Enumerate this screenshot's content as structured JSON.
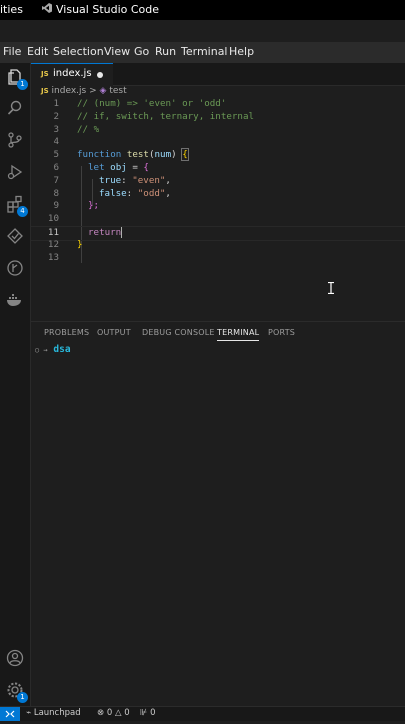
{
  "system_bar": {
    "left_text": "ities",
    "app_name": "Visual Studio Code"
  },
  "menu": [
    "File",
    "Edit",
    "Selection",
    "View",
    "Go",
    "Run",
    "Terminal",
    "Help"
  ],
  "activity": {
    "explorer_badge": "1",
    "extensions_badge": "4",
    "settings_badge": "1"
  },
  "tab": {
    "file_label": "index.js",
    "js_badge": "JS"
  },
  "breadcrumb": {
    "file": "index.js",
    "sep": ">",
    "symbol": "test"
  },
  "code": {
    "line_numbers": [
      "1",
      "2",
      "3",
      "4",
      "5",
      "6",
      "7",
      "8",
      "9",
      "10",
      "11",
      "12",
      "13"
    ],
    "l1": "// (num) => 'even' or 'odd'",
    "l2": "// if, switch, ternary, internal",
    "l3": "// %",
    "l5_kw": "function",
    "l5_fn": "test",
    "l5_open": "(",
    "l5_param": "num",
    "l5_close": ")",
    "l5_brace": "{",
    "l6_kw": "let",
    "l6_var": "obj",
    "l6_eq": "=",
    "l6_brace": "{",
    "l7_key": "true",
    "l7_str": "\"even\"",
    "l8_key": "false",
    "l8_str": "\"odd\"",
    "l9": "};",
    "l11_kw": "return",
    "l12_brace": "}"
  },
  "panel": {
    "tabs": [
      "PROBLEMS",
      "OUTPUT",
      "DEBUG CONSOLE",
      "TERMINAL",
      "PORTS"
    ],
    "active_tab": "TERMINAL",
    "prompt_symbol": "○ →",
    "prompt_dir": "dsa"
  },
  "status": {
    "launchpad": "Launchpad",
    "errors": "0",
    "warnings": "0",
    "ports": "0"
  },
  "colors": {
    "accent": "#0078d4",
    "comment": "#6a9955",
    "keyword": "#569cd6",
    "string": "#ce9178"
  }
}
